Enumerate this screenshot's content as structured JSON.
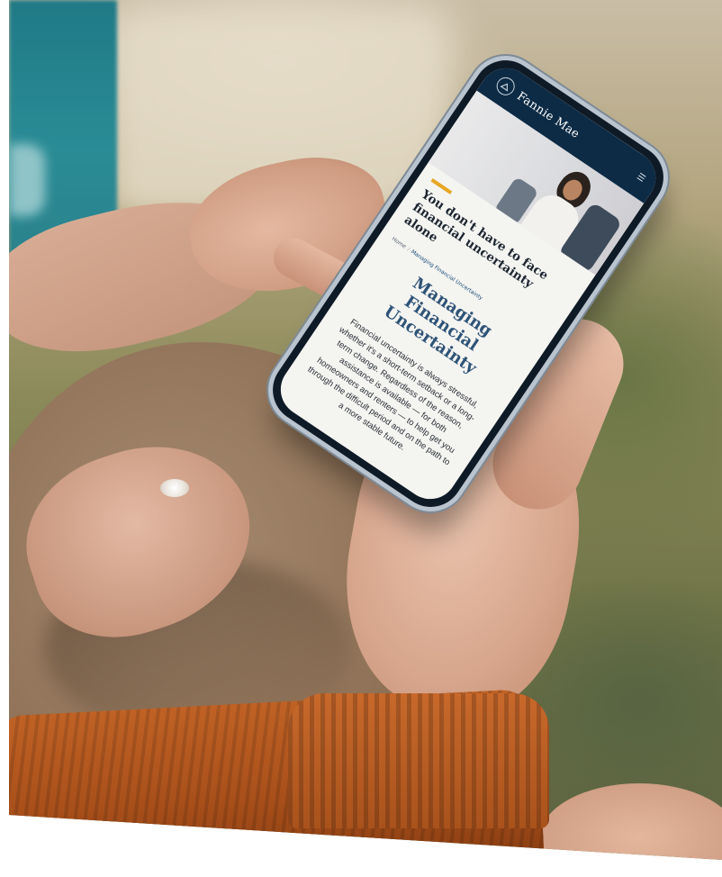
{
  "app": {
    "brand_name": "Fannie Mae",
    "brand_icon": "fannie-mae-logo-icon",
    "menu_icon": "menu-icon"
  },
  "hero": {
    "headline": "You don't have to face financial uncertainty alone",
    "accent_color": "#e7a725"
  },
  "breadcrumb": {
    "items": [
      "Home",
      "Managing Financial Uncertainty"
    ]
  },
  "page": {
    "title": "Managing Financial Uncertainty",
    "body": "Financial uncertainty is always stressful, whether it's a short-term setback or a long-term change. Regardless of the reason, assistance is available — for both homeowners and renters — to help get you through the difficult period and on the path to a more stable future."
  },
  "colors": {
    "header_bg": "#0d2b45",
    "title_blue": "#2e5377",
    "sweater": "#b2561e"
  }
}
